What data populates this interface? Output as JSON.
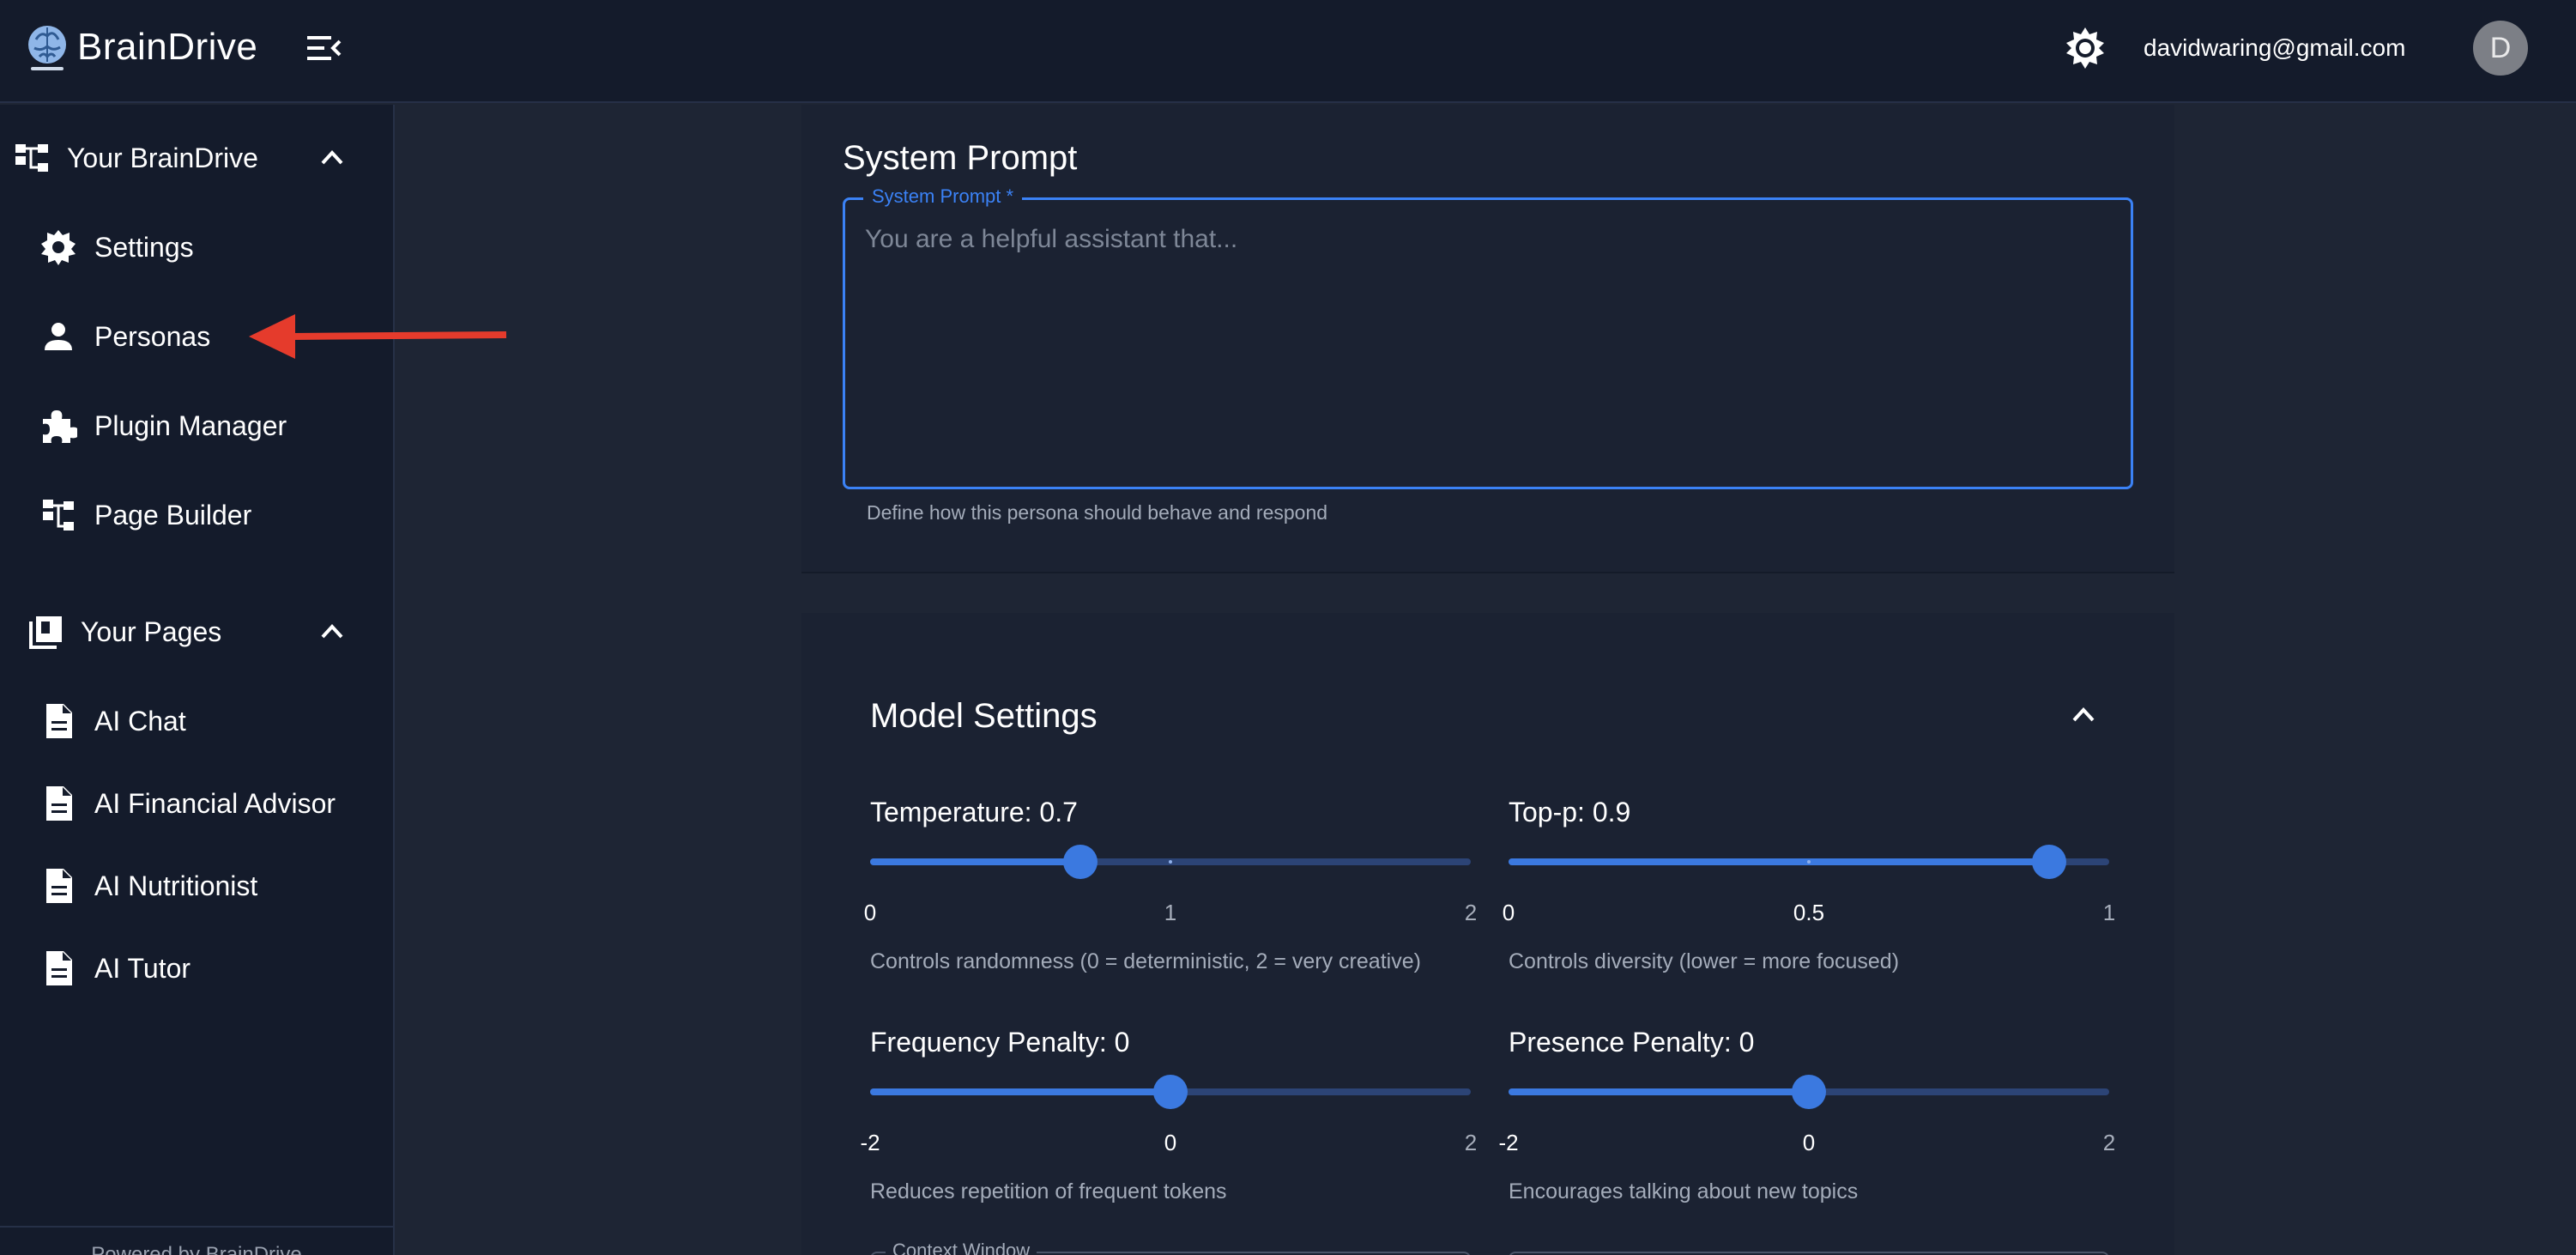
{
  "header": {
    "app_name": "BrainDrive",
    "user_email": "davidwaring@gmail.com",
    "avatar_initial": "D"
  },
  "sidebar": {
    "section_brain": {
      "label": "Your BrainDrive"
    },
    "brain_items": [
      {
        "label": "Settings",
        "icon": "gear-icon"
      },
      {
        "label": "Personas",
        "icon": "person-icon"
      },
      {
        "label": "Plugin Manager",
        "icon": "puzzle-icon"
      },
      {
        "label": "Page Builder",
        "icon": "sitemap-icon"
      }
    ],
    "section_pages": {
      "label": "Your Pages"
    },
    "page_items": [
      {
        "label": "AI Chat",
        "icon": "document-icon"
      },
      {
        "label": "AI Financial Advisor",
        "icon": "document-icon"
      },
      {
        "label": "AI Nutritionist",
        "icon": "document-icon"
      },
      {
        "label": "AI Tutor",
        "icon": "document-icon"
      }
    ],
    "footer": "Powered by BrainDrive"
  },
  "system_prompt": {
    "title": "System Prompt",
    "field_label": "System Prompt *",
    "placeholder": "You are a helpful assistant that...",
    "value": "",
    "helper": "Define how this persona should behave and respond"
  },
  "model_settings": {
    "title": "Model Settings",
    "sliders": [
      {
        "label": "Temperature: 0.7",
        "value": 0.7,
        "min": 0,
        "max": 2,
        "marks": [
          "0",
          "1",
          "2"
        ],
        "helper": "Controls randomness (0 = deterministic, 2 = very creative)"
      },
      {
        "label": "Top-p: 0.9",
        "value": 0.9,
        "min": 0,
        "max": 1,
        "marks": [
          "0",
          "0.5",
          "1"
        ],
        "helper": "Controls diversity (lower = more focused)"
      },
      {
        "label": "Frequency Penalty: 0",
        "value": 0,
        "min": -2,
        "max": 2,
        "marks": [
          "-2",
          "0",
          "2"
        ],
        "helper": "Reduces repetition of frequent tokens"
      },
      {
        "label": "Presence Penalty: 0",
        "value": 0,
        "min": -2,
        "max": 2,
        "marks": [
          "-2",
          "0",
          "2"
        ],
        "helper": "Encourages talking about new topics"
      }
    ],
    "context_window_label": "Context Window"
  },
  "colors": {
    "accent": "#3b82f6",
    "annotation_arrow": "#e53b2c"
  }
}
